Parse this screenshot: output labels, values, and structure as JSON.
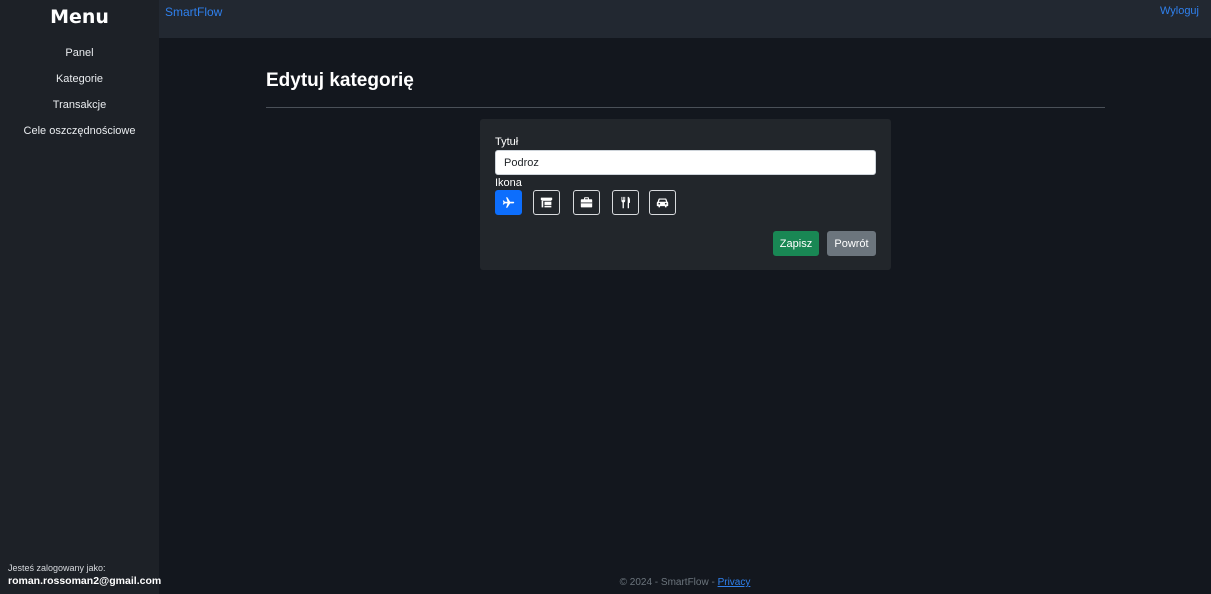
{
  "sidebar": {
    "title": "Menu",
    "items": [
      {
        "label": "Panel"
      },
      {
        "label": "Kategorie"
      },
      {
        "label": "Transakcje"
      },
      {
        "label": "Cele oszczędnościowe"
      }
    ],
    "user_label": "Jesteś zalogowany jako:",
    "user_email": "roman.rossoman2@gmail.com"
  },
  "topbar": {
    "brand": "SmartFlow",
    "logout": "Wyloguj"
  },
  "main": {
    "title": "Edytuj kategorię",
    "form": {
      "title_label": "Tytuł",
      "title_value": "Podroz",
      "icon_label": "Ikona",
      "icons": [
        {
          "name": "plane-icon",
          "selected": true
        },
        {
          "name": "shop-icon",
          "selected": false
        },
        {
          "name": "briefcase-icon",
          "selected": false
        },
        {
          "name": "utensils-icon",
          "selected": false
        },
        {
          "name": "car-icon",
          "selected": false
        }
      ],
      "save_label": "Zapisz",
      "back_label": "Powrót"
    }
  },
  "footer": {
    "text": "© 2024 - SmartFlow - ",
    "privacy": "Privacy"
  },
  "colors": {
    "accent": "#0d6efd",
    "link": "#2f80ed",
    "save": "#198754",
    "back": "#6c757d",
    "background": "#13171e",
    "sidebar": "#1d2127",
    "card": "#22262b"
  }
}
